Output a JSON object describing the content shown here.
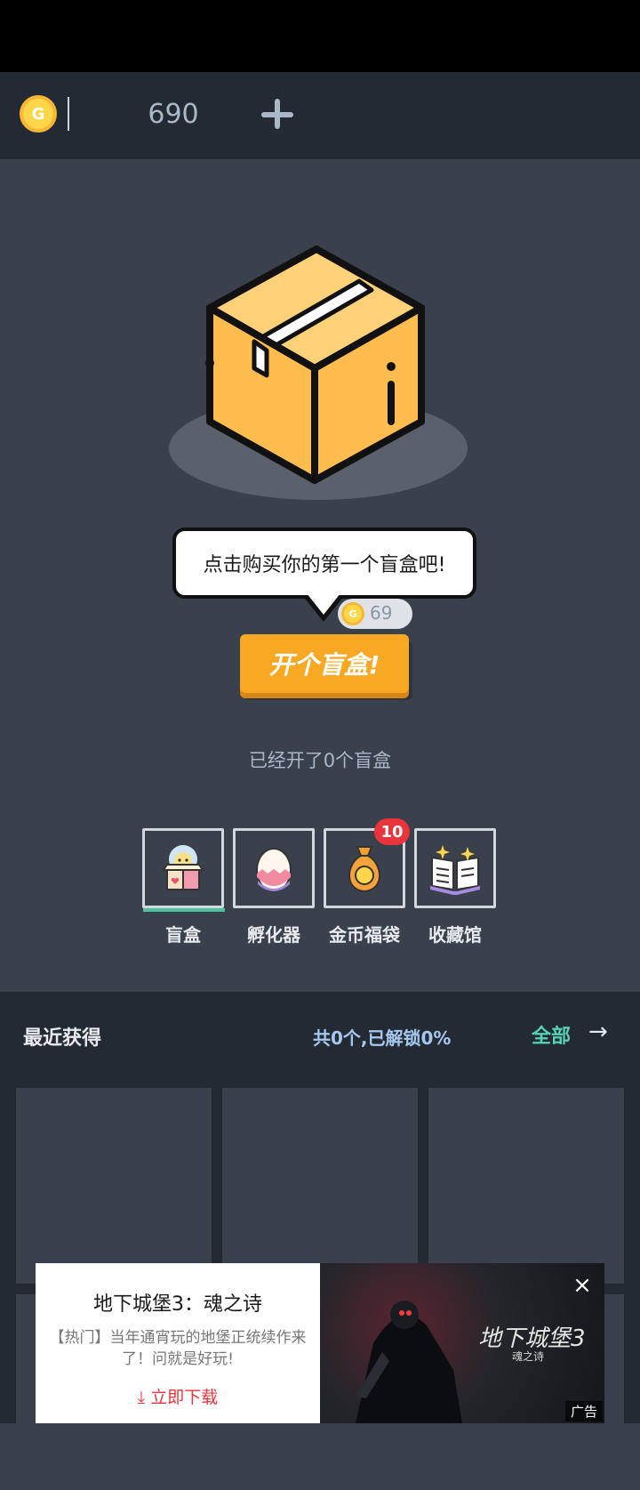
{
  "coin_bar": {
    "coin_letter": "G",
    "amount": "690"
  },
  "blind_box": {
    "prompt": "点击购买你的第一个盲盒吧!",
    "price_coin_letter": "G",
    "price": "69",
    "open_button": "开个盲盒!",
    "opened_count": "已经开了0个盲盒"
  },
  "tabs": [
    {
      "label": "盲盒",
      "icon": "blind-box-icon"
    },
    {
      "label": "孵化器",
      "icon": "egg-icon"
    },
    {
      "label": "金币福袋",
      "icon": "coin-bag-icon",
      "badge": "10"
    },
    {
      "label": "收藏馆",
      "icon": "book-icon"
    }
  ],
  "recent": {
    "title": "最近获得",
    "stats": "共0个,已解锁0%",
    "all_label": "全部",
    "arrow": "→"
  },
  "ad": {
    "title": "地下城堡3：魂之诗",
    "description": "【热门】当年通宵玩的地堡正统续作来了！问就是好玩!",
    "download": "⤓ 立即下载",
    "close": "×",
    "game_title": "地下城堡3",
    "game_subtitle": "魂之诗",
    "tag": "广告"
  },
  "colors": {
    "accent_orange": "#f8a822",
    "accent_green": "#55d3b0",
    "badge_red": "#e8343a",
    "coin_yellow": "#ffd54a"
  }
}
